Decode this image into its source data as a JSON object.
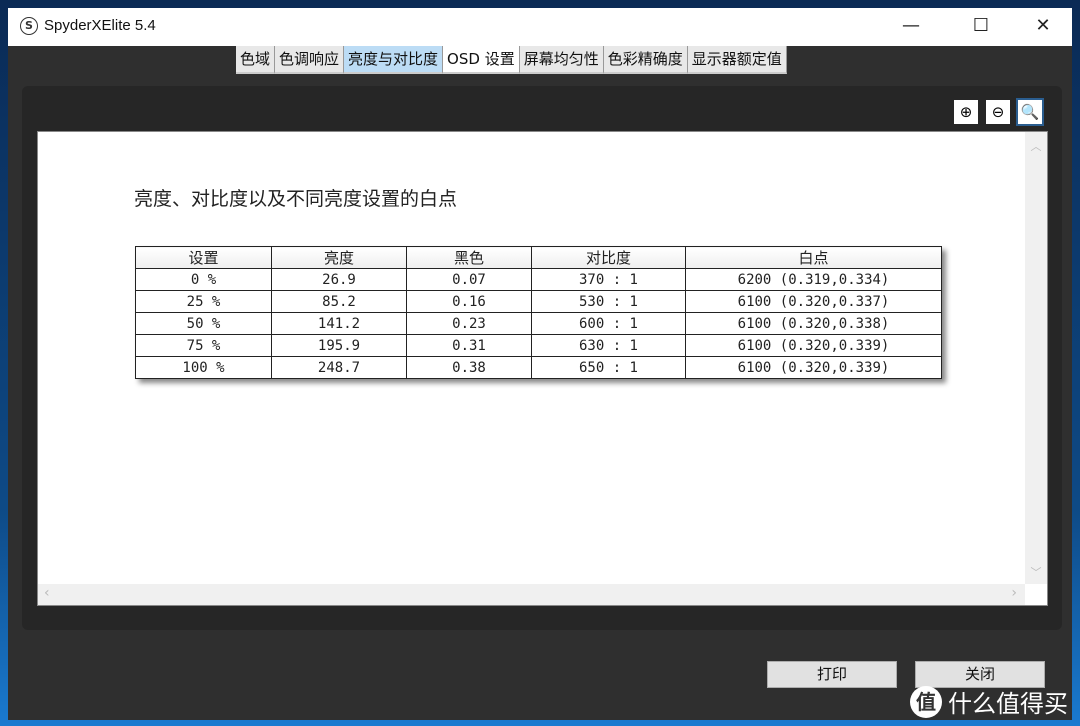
{
  "window": {
    "title": "SpyderXElite 5.4",
    "minimize": "—",
    "maximize": "☐",
    "close": "✕"
  },
  "tabs": [
    "色域",
    "色调响应",
    "亮度与对比度",
    "OSD 设置",
    "屏幕均匀性",
    "色彩精确度",
    "显示器额定值"
  ],
  "active_tab": "亮度与对比度",
  "zoom": {
    "zoom_in": "⊕",
    "zoom_out": "⊖",
    "fit": "🔍"
  },
  "report": {
    "title": "亮度、对比度以及不同亮度设置的白点",
    "headers": [
      "设置",
      "亮度",
      "黑色",
      "对比度",
      "白点"
    ],
    "rows": [
      [
        "0 %",
        "26.9",
        "0.07",
        "370 : 1",
        "6200 (0.319,0.334)"
      ],
      [
        "25 %",
        "85.2",
        "0.16",
        "530 : 1",
        "6100 (0.320,0.337)"
      ],
      [
        "50 %",
        "141.2",
        "0.23",
        "600 : 1",
        "6100 (0.320,0.338)"
      ],
      [
        "75 %",
        "195.9",
        "0.31",
        "630 : 1",
        "6100 (0.320,0.339)"
      ],
      [
        "100 %",
        "248.7",
        "0.38",
        "650 : 1",
        "6100 (0.320,0.339)"
      ]
    ]
  },
  "buttons": {
    "print": "打印",
    "close": "关闭"
  },
  "watermark": {
    "icon": "值",
    "text": "什么值得买"
  }
}
